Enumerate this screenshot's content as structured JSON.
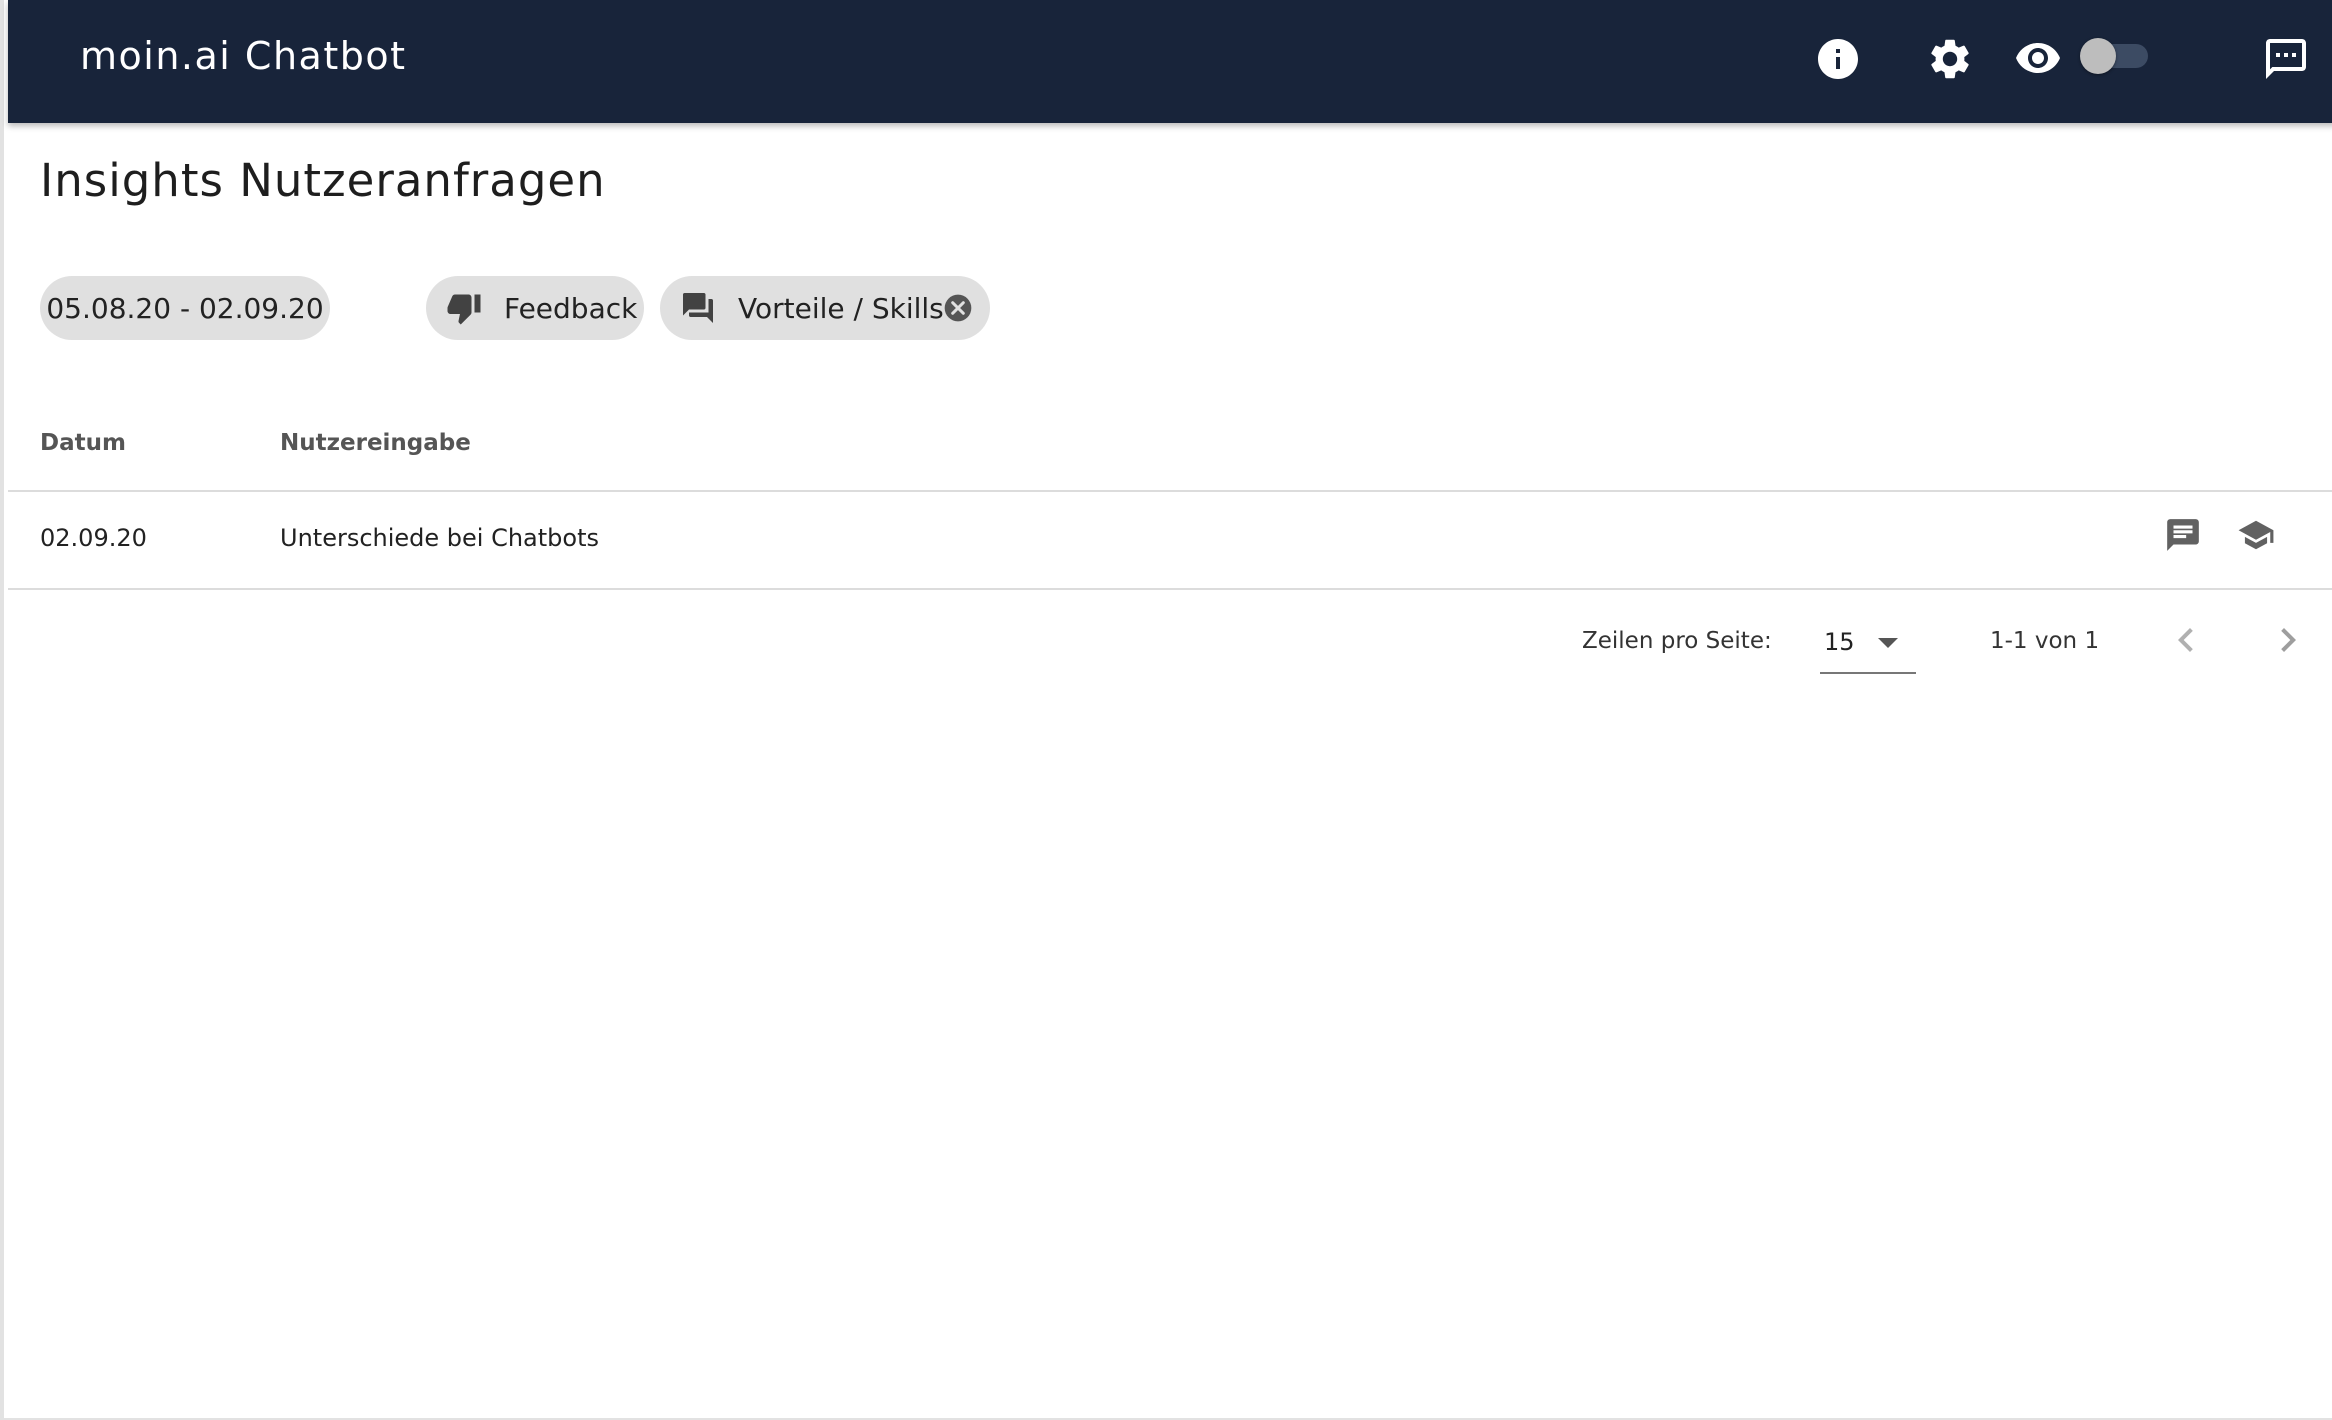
{
  "app": {
    "title": "moin.ai Chatbot"
  },
  "toolbar": {
    "icons": [
      "info-icon",
      "gear-icon",
      "eye-icon",
      "chat-icon"
    ],
    "preview_toggle_on": false
  },
  "page": {
    "title": "Insights Nutzeranfragen"
  },
  "filters": {
    "date_range": "05.08.20 - 02.09.20",
    "feedback_label": "Feedback",
    "topic_label": "Vorteile / Skills"
  },
  "table": {
    "headers": {
      "date": "Datum",
      "input": "Nutzereingabe"
    },
    "rows": [
      {
        "date": "02.09.20",
        "input": "Unterschiede bei Chatbots"
      }
    ]
  },
  "pagination": {
    "rows_per_page_label": "Zeilen pro Seite:",
    "rows_per_page_value": "15",
    "range": "1-1 von 1"
  },
  "colors": {
    "appbar": "#18243a",
    "chip": "#e0e0e0",
    "icon_grey": "#616161"
  }
}
